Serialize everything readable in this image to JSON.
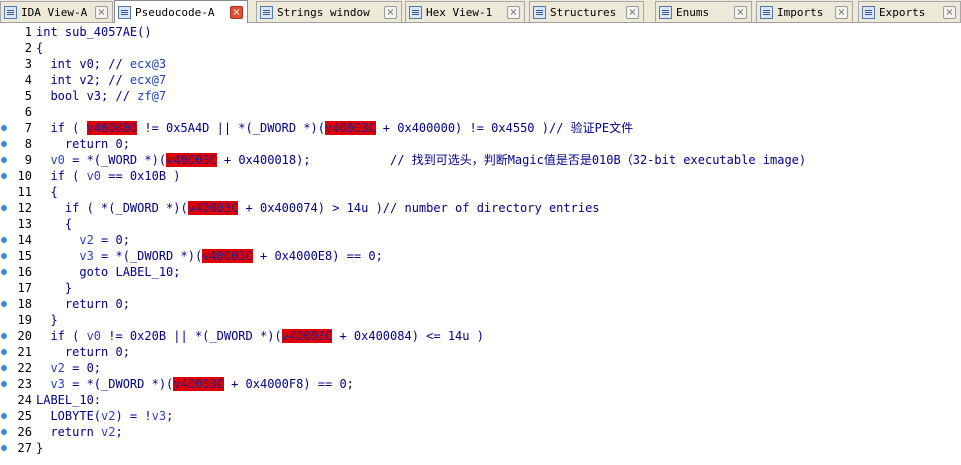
{
  "tabs": [
    {
      "label": "IDA View-A",
      "icon": "ida-view-icon",
      "active": false
    },
    {
      "label": "Pseudocode-A",
      "icon": "pseudocode-icon",
      "active": true
    },
    {
      "label": "Strings window",
      "icon": "strings-icon",
      "active": false
    },
    {
      "label": "Hex View-1",
      "icon": "hex-view-icon",
      "active": false
    },
    {
      "label": "Structures",
      "icon": "structures-icon",
      "active": false
    },
    {
      "label": "Enums",
      "icon": "enums-icon",
      "active": false
    },
    {
      "label": "Imports",
      "icon": "imports-icon",
      "active": false
    },
    {
      "label": "Exports",
      "icon": "exports-icon",
      "active": false
    }
  ],
  "close_glyph": "×",
  "code": {
    "lines": [
      {
        "num": "1",
        "dot": false,
        "segs": [
          {
            "t": "int sub_4057AE()",
            "c": "k"
          }
        ]
      },
      {
        "num": "2",
        "dot": false,
        "segs": [
          {
            "t": "{",
            "c": "k"
          }
        ]
      },
      {
        "num": "3",
        "dot": false,
        "segs": [
          {
            "t": "  int v0; // ",
            "c": "k"
          },
          {
            "t": "ecx@3",
            "c": "c"
          }
        ]
      },
      {
        "num": "4",
        "dot": false,
        "segs": [
          {
            "t": "  int v2; // ",
            "c": "k"
          },
          {
            "t": "ecx@7",
            "c": "c"
          }
        ]
      },
      {
        "num": "5",
        "dot": false,
        "segs": [
          {
            "t": "  bool v3; // ",
            "c": "k"
          },
          {
            "t": "zf@7",
            "c": "c"
          }
        ]
      },
      {
        "num": "6",
        "dot": false,
        "segs": [
          {
            "t": "",
            "c": "k"
          }
        ]
      },
      {
        "num": "7",
        "dot": true,
        "segs": [
          {
            "t": "  if ( ",
            "c": "k"
          },
          {
            "t": "v400000",
            "c": "hl"
          },
          {
            "t": " != 0x5A4D || *(_DWORD *)(",
            "c": "k"
          },
          {
            "t": "v40003C",
            "c": "hl"
          },
          {
            "t": " + 0x400000) != 0x4550 )// 验证PE文件",
            "c": "k"
          }
        ]
      },
      {
        "num": "8",
        "dot": true,
        "segs": [
          {
            "t": "    return 0;",
            "c": "k"
          }
        ]
      },
      {
        "num": "9",
        "dot": true,
        "segs": [
          {
            "t": "  ",
            "c": "k"
          },
          {
            "t": "v0",
            "c": "v"
          },
          {
            "t": " = *(_WORD *)(",
            "c": "k"
          },
          {
            "t": "v40003C",
            "c": "hl"
          },
          {
            "t": " + 0x400018);           // 找到可选头，判断Magic值是否是010B（32-bit executable image)",
            "c": "k"
          }
        ]
      },
      {
        "num": "10",
        "dot": true,
        "segs": [
          {
            "t": "  if ( ",
            "c": "k"
          },
          {
            "t": "v0",
            "c": "v"
          },
          {
            "t": " == 0x10B )",
            "c": "k"
          }
        ]
      },
      {
        "num": "11",
        "dot": false,
        "segs": [
          {
            "t": "  {",
            "c": "k"
          }
        ]
      },
      {
        "num": "12",
        "dot": true,
        "segs": [
          {
            "t": "    if ( *(_DWORD *)(",
            "c": "k"
          },
          {
            "t": "v40003C",
            "c": "hl"
          },
          {
            "t": " + 0x400074) > 14u )// number of directory entries",
            "c": "k"
          }
        ]
      },
      {
        "num": "13",
        "dot": false,
        "segs": [
          {
            "t": "    {",
            "c": "k"
          }
        ]
      },
      {
        "num": "14",
        "dot": true,
        "segs": [
          {
            "t": "      ",
            "c": "k"
          },
          {
            "t": "v2",
            "c": "v"
          },
          {
            "t": " = 0;",
            "c": "k"
          }
        ]
      },
      {
        "num": "15",
        "dot": true,
        "segs": [
          {
            "t": "      ",
            "c": "k"
          },
          {
            "t": "v3",
            "c": "v"
          },
          {
            "t": " = *(_DWORD *)(",
            "c": "k"
          },
          {
            "t": "v40003C",
            "c": "hl"
          },
          {
            "t": " + 0x4000E8) == 0;",
            "c": "k"
          }
        ]
      },
      {
        "num": "16",
        "dot": true,
        "segs": [
          {
            "t": "      goto LABEL_10;",
            "c": "k"
          }
        ]
      },
      {
        "num": "17",
        "dot": false,
        "segs": [
          {
            "t": "    }",
            "c": "k"
          }
        ]
      },
      {
        "num": "18",
        "dot": true,
        "segs": [
          {
            "t": "    return 0;",
            "c": "k"
          }
        ]
      },
      {
        "num": "19",
        "dot": false,
        "segs": [
          {
            "t": "  }",
            "c": "k"
          }
        ]
      },
      {
        "num": "20",
        "dot": true,
        "segs": [
          {
            "t": "  if ( ",
            "c": "k"
          },
          {
            "t": "v0",
            "c": "v"
          },
          {
            "t": " != 0x20B || *(_DWORD *)(",
            "c": "k"
          },
          {
            "t": "v40003C",
            "c": "hl"
          },
          {
            "t": " + 0x400084) <= 14u )",
            "c": "k"
          }
        ]
      },
      {
        "num": "21",
        "dot": true,
        "segs": [
          {
            "t": "    return 0;",
            "c": "k"
          }
        ]
      },
      {
        "num": "22",
        "dot": true,
        "segs": [
          {
            "t": "  ",
            "c": "k"
          },
          {
            "t": "v2",
            "c": "v"
          },
          {
            "t": " = 0;",
            "c": "k"
          }
        ]
      },
      {
        "num": "23",
        "dot": true,
        "segs": [
          {
            "t": "  ",
            "c": "k"
          },
          {
            "t": "v3",
            "c": "v"
          },
          {
            "t": " = *(_DWORD *)(",
            "c": "k"
          },
          {
            "t": "v40003C",
            "c": "hl"
          },
          {
            "t": " + 0x4000F8) == 0;",
            "c": "k"
          }
        ]
      },
      {
        "num": "24",
        "dot": false,
        "segs": [
          {
            "t": "LABEL_10:",
            "c": "k"
          }
        ]
      },
      {
        "num": "25",
        "dot": true,
        "segs": [
          {
            "t": "  LOBYTE(",
            "c": "k"
          },
          {
            "t": "v2",
            "c": "v"
          },
          {
            "t": ") = !",
            "c": "k"
          },
          {
            "t": "v3",
            "c": "v"
          },
          {
            "t": ";",
            "c": "k"
          }
        ]
      },
      {
        "num": "26",
        "dot": true,
        "segs": [
          {
            "t": "  return ",
            "c": "k"
          },
          {
            "t": "v2",
            "c": "v"
          },
          {
            "t": ";",
            "c": "k"
          }
        ]
      },
      {
        "num": "27",
        "dot": true,
        "segs": [
          {
            "t": "}",
            "c": "k"
          }
        ]
      }
    ]
  },
  "colors": {
    "highlight": "#e00000",
    "keyword": "#00008b",
    "comment_reg": "#1a3dbb",
    "breakpoint_dot": "#3a8fd8"
  }
}
